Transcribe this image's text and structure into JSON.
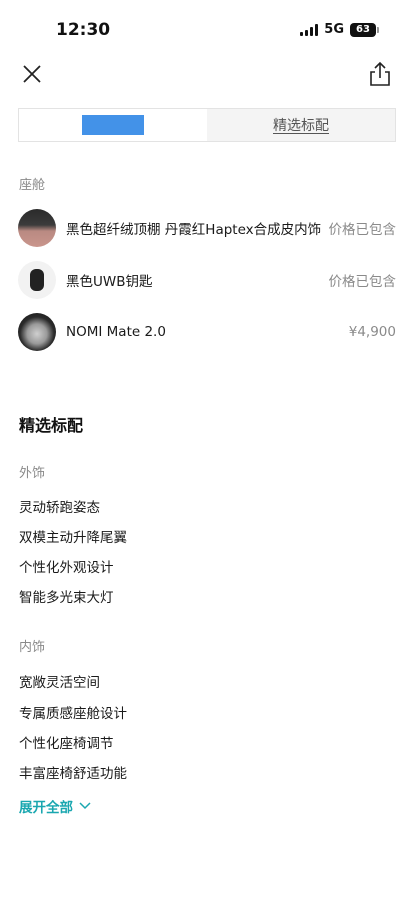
{
  "status_bar": {
    "time": "12:30",
    "network": "5G",
    "battery": "63"
  },
  "tabs": {
    "first_label": "",
    "second_label": "精选标配"
  },
  "cabin": {
    "label": "座舱",
    "items": [
      {
        "name": "黑色超纤绒顶棚 丹霞红Haptex合成皮内饰",
        "price": "价格已包含"
      },
      {
        "name": "黑色UWB钥匙",
        "price": "价格已包含"
      },
      {
        "name": "NOMI Mate 2.0",
        "price": "¥4,900"
      }
    ]
  },
  "standard": {
    "title": "精选标配",
    "exterior": {
      "label": "外饰",
      "items": [
        "灵动轿跑姿态",
        "双模主动升降尾翼",
        "个性化外观设计",
        "智能多光束大灯"
      ]
    },
    "interior": {
      "label": "内饰",
      "items": [
        "宽敞灵活空间",
        "专属质感座舱设计",
        "个性化座椅调节",
        "丰富座椅舒适功能"
      ]
    },
    "expand_label": "展开全部"
  },
  "colors": {
    "accent": "#1aa7b0",
    "muted": "#8a8a8a",
    "redaction": "#2f86e6"
  }
}
